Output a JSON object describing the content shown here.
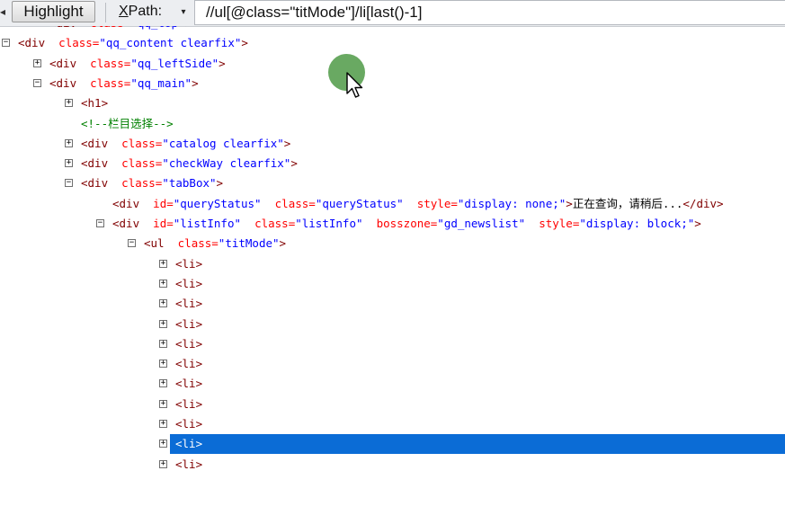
{
  "toolbar": {
    "highlight_label": "Highlight",
    "xpath_accel": "X",
    "xpath_rest": "Path:",
    "dropdown_glyph": "▾",
    "xpath_value": "//ul[@class=\"titMode\"]/li[last()-1]"
  },
  "tree": {
    "rows": [
      {
        "indent": 1,
        "exp": "",
        "parts": [
          [
            "t",
            "<div"
          ],
          [
            "p",
            "  "
          ],
          [
            "a",
            "class="
          ],
          [
            "v",
            "\"qq_top\""
          ],
          [
            "t",
            ">"
          ]
        ],
        "partial": true
      },
      {
        "indent": 0,
        "exp": "−",
        "parts": [
          [
            "t",
            "<div"
          ],
          [
            "p",
            "  "
          ],
          [
            "a",
            "class="
          ],
          [
            "v",
            "\"qq_content clearfix\""
          ],
          [
            "t",
            ">"
          ]
        ]
      },
      {
        "indent": 1,
        "exp": "+",
        "parts": [
          [
            "t",
            "<div"
          ],
          [
            "p",
            "  "
          ],
          [
            "a",
            "class="
          ],
          [
            "v",
            "\"qq_leftSide\""
          ],
          [
            "t",
            ">"
          ]
        ]
      },
      {
        "indent": 1,
        "exp": "−",
        "parts": [
          [
            "t",
            "<div"
          ],
          [
            "p",
            "  "
          ],
          [
            "a",
            "class="
          ],
          [
            "v",
            "\"qq_main\""
          ],
          [
            "t",
            ">"
          ]
        ]
      },
      {
        "indent": 2,
        "exp": "+",
        "parts": [
          [
            "t",
            "<h1>"
          ]
        ]
      },
      {
        "indent": 2,
        "exp": "",
        "parts": [
          [
            "c",
            "<!--栏目选择-->"
          ]
        ]
      },
      {
        "indent": 2,
        "exp": "+",
        "parts": [
          [
            "t",
            "<div"
          ],
          [
            "p",
            "  "
          ],
          [
            "a",
            "class="
          ],
          [
            "v",
            "\"catalog clearfix\""
          ],
          [
            "t",
            ">"
          ]
        ]
      },
      {
        "indent": 2,
        "exp": "+",
        "parts": [
          [
            "t",
            "<div"
          ],
          [
            "p",
            "  "
          ],
          [
            "a",
            "class="
          ],
          [
            "v",
            "\"checkWay clearfix\""
          ],
          [
            "t",
            ">"
          ]
        ]
      },
      {
        "indent": 2,
        "exp": "−",
        "parts": [
          [
            "t",
            "<div"
          ],
          [
            "p",
            "  "
          ],
          [
            "a",
            "class="
          ],
          [
            "v",
            "\"tabBox\""
          ],
          [
            "t",
            ">"
          ]
        ]
      },
      {
        "indent": 3,
        "exp": "",
        "parts": [
          [
            "t",
            "<div"
          ],
          [
            "p",
            "  "
          ],
          [
            "a",
            "id="
          ],
          [
            "v",
            "\"queryStatus\""
          ],
          [
            "p",
            "  "
          ],
          [
            "a",
            "class="
          ],
          [
            "v",
            "\"queryStatus\""
          ],
          [
            "p",
            "  "
          ],
          [
            "a",
            "style="
          ],
          [
            "v",
            "\"display: none;\""
          ],
          [
            "t",
            ">"
          ],
          [
            "p",
            "正在查询，请稍后..."
          ],
          [
            "t",
            "</div>"
          ]
        ]
      },
      {
        "indent": 3,
        "exp": "−",
        "parts": [
          [
            "t",
            "<div"
          ],
          [
            "p",
            "  "
          ],
          [
            "a",
            "id="
          ],
          [
            "v",
            "\"listInfo\""
          ],
          [
            "p",
            "  "
          ],
          [
            "a",
            "class="
          ],
          [
            "v",
            "\"listInfo\""
          ],
          [
            "p",
            "  "
          ],
          [
            "a",
            "bosszone="
          ],
          [
            "v",
            "\"gd_newslist\""
          ],
          [
            "p",
            "  "
          ],
          [
            "a",
            "style="
          ],
          [
            "v",
            "\"display: block;\""
          ],
          [
            "t",
            ">"
          ]
        ]
      },
      {
        "indent": 4,
        "exp": "−",
        "parts": [
          [
            "t",
            "<ul"
          ],
          [
            "p",
            "  "
          ],
          [
            "a",
            "class="
          ],
          [
            "v",
            "\"titMode\""
          ],
          [
            "t",
            ">"
          ]
        ]
      },
      {
        "indent": 5,
        "exp": "+",
        "parts": [
          [
            "t",
            "<li>"
          ]
        ]
      },
      {
        "indent": 5,
        "exp": "+",
        "parts": [
          [
            "t",
            "<li>"
          ]
        ]
      },
      {
        "indent": 5,
        "exp": "+",
        "parts": [
          [
            "t",
            "<li>"
          ]
        ]
      },
      {
        "indent": 5,
        "exp": "+",
        "parts": [
          [
            "t",
            "<li>"
          ]
        ]
      },
      {
        "indent": 5,
        "exp": "+",
        "parts": [
          [
            "t",
            "<li>"
          ]
        ]
      },
      {
        "indent": 5,
        "exp": "+",
        "parts": [
          [
            "t",
            "<li>"
          ]
        ]
      },
      {
        "indent": 5,
        "exp": "+",
        "parts": [
          [
            "t",
            "<li>"
          ]
        ]
      },
      {
        "indent": 5,
        "exp": "+",
        "parts": [
          [
            "t",
            "<li>"
          ]
        ]
      },
      {
        "indent": 5,
        "exp": "+",
        "parts": [
          [
            "t",
            "<li>"
          ]
        ]
      },
      {
        "indent": 5,
        "exp": "+",
        "parts": [
          [
            "t",
            "<li>"
          ]
        ],
        "selected": true
      },
      {
        "indent": 5,
        "exp": "+",
        "parts": [
          [
            "t",
            "<li>"
          ]
        ]
      }
    ]
  },
  "colors": {
    "tag": "#800000",
    "attr_name": "#ff0000",
    "attr_value": "#0000ff",
    "comment": "#008000",
    "selection": "#0b6cd6"
  },
  "icons": [
    "expand-icon",
    "collapse-icon",
    "mouse-cursor-icon",
    "click-indicator",
    "chevron-down-icon"
  ]
}
